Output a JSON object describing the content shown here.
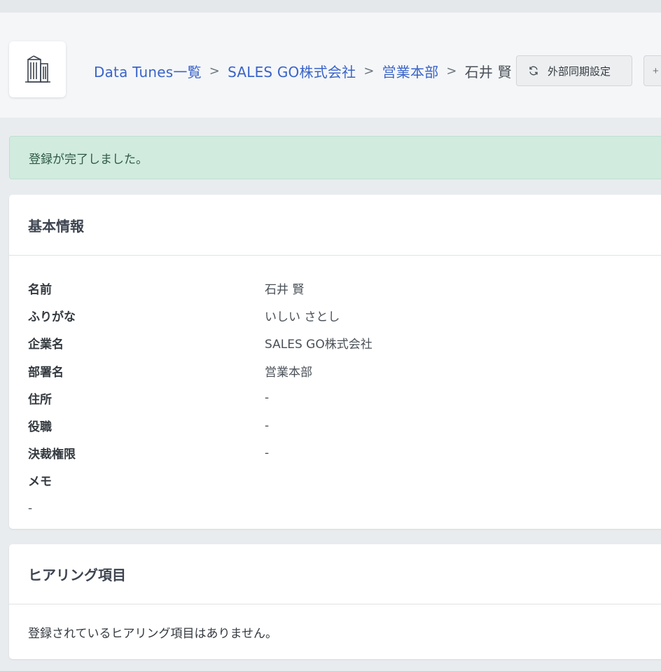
{
  "breadcrumb": {
    "items": [
      "Data Tunes一覧",
      "SALES GO株式会社",
      "営業本部"
    ],
    "separator": ">",
    "current": "石井 賢"
  },
  "header": {
    "sync_button_label": "外部同期設定",
    "next_button_label": "+"
  },
  "icons": {
    "logo": "building-icon",
    "sync": "refresh-icon"
  },
  "alert": {
    "message": "登録が完了しました。"
  },
  "basic_info": {
    "title": "基本情報",
    "fields": [
      {
        "label": "名前",
        "value": "石井 賢"
      },
      {
        "label": "ふりがな",
        "value": "いしい さとし"
      },
      {
        "label": "企業名",
        "value": "SALES GO株式会社"
      },
      {
        "label": "部署名",
        "value": "営業本部"
      },
      {
        "label": "住所",
        "value": "-"
      },
      {
        "label": "役職",
        "value": "-"
      },
      {
        "label": "決裁権限",
        "value": "-"
      }
    ],
    "memo_label": "メモ",
    "memo_value": "-"
  },
  "hearing": {
    "title": "ヒアリング項目",
    "empty_message": "登録されているヒアリング項目はありません。"
  },
  "colors": {
    "link": "#3a64c8",
    "alert_bg": "#d1ebdf",
    "page_bg": "#e9ecef"
  }
}
